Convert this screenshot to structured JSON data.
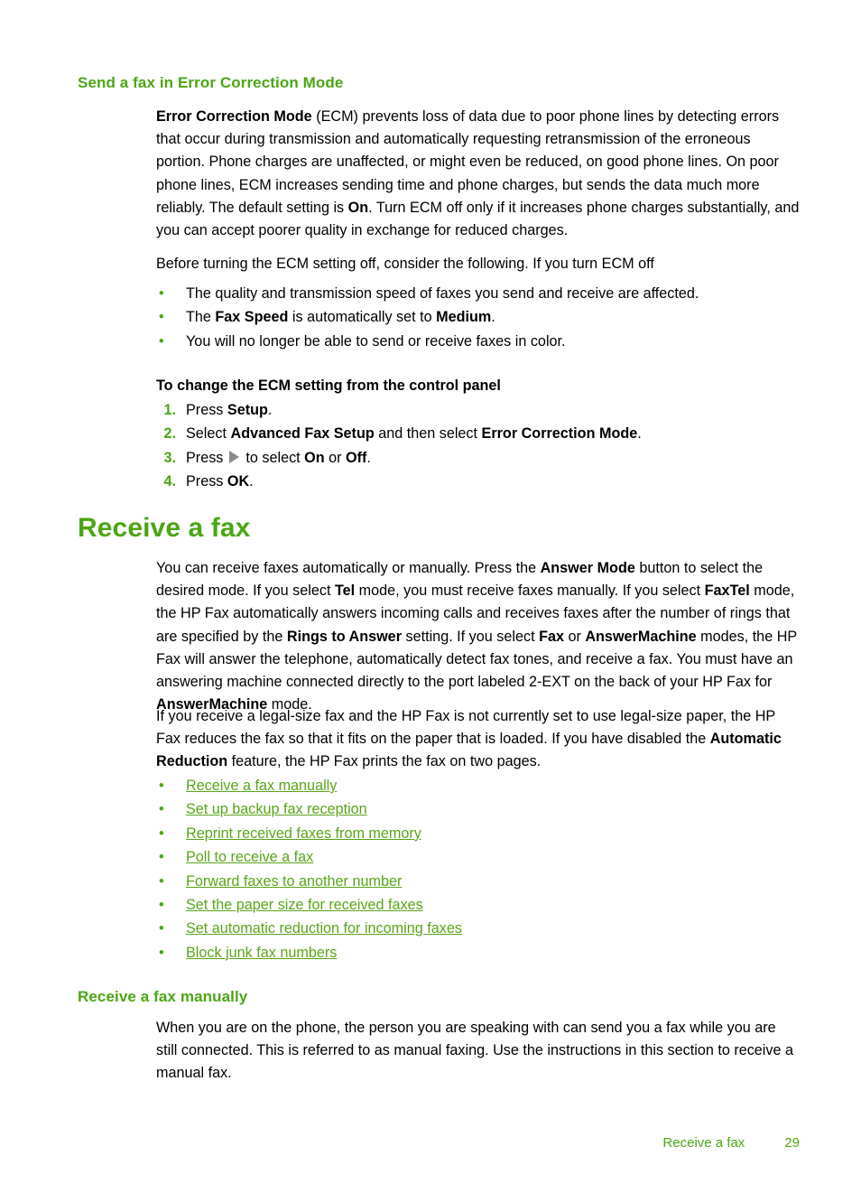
{
  "colors": {
    "heading_green": "#4ba614",
    "link_green": "#58a618",
    "body_black": "#000000",
    "arrow_gray": "#8a8a8a"
  },
  "section_ecm": {
    "heading": "Send a fax in Error Correction Mode",
    "paragraph_lead_bold": "Error Correction Mode",
    "paragraph_rest_1": " (ECM) prevents loss of data due to poor phone lines by detecting errors that occur during transmission and automatically requesting retransmission of the erroneous portion. Phone charges are unaffected, or might even be reduced, on good phone lines. On poor phone lines, ECM increases sending time and phone charges, but sends the data much more reliably. The default setting is ",
    "paragraph_bold_2": "On",
    "paragraph_rest_2": ". Turn ECM off only if it increases phone charges substantially, and you can accept poorer quality in exchange for reduced charges.",
    "intro": "Before turning the ECM setting off, consider the following. If you turn ECM off",
    "bullets": [
      {
        "bullet": "•",
        "pre": "The quality and transmission speed of faxes you send and receive are affected.",
        "bold1": "",
        "mid": "",
        "bold2": "",
        "post": ""
      },
      {
        "bullet": "•",
        "pre": "The ",
        "bold1": "Fax Speed",
        "mid": " is automatically set to ",
        "bold2": "Medium",
        "post": "."
      },
      {
        "bullet": "•",
        "pre": "You will no longer be able to send or receive faxes in color.",
        "bold1": "",
        "mid": "",
        "bold2": "",
        "post": ""
      }
    ],
    "procedure_title": "To change the ECM setting from the control panel",
    "steps": [
      {
        "num": "1.",
        "pre": "Press ",
        "bold1": "Setup",
        "mid": "",
        "bold2": "",
        "post": ".",
        "has_arrow": false
      },
      {
        "num": "2.",
        "pre": "Select ",
        "bold1": "Advanced Fax Setup",
        "mid": " and then select ",
        "bold2": "Error Correction Mode",
        "post": ".",
        "has_arrow": false
      },
      {
        "num": "3.",
        "pre": "Press ",
        "bold1": "",
        "mid": " to select ",
        "bold2": "On",
        "post": " or ",
        "has_arrow": true,
        "tail_bold": "Off",
        "tail_post": "."
      },
      {
        "num": "4.",
        "pre": "Press ",
        "bold1": "OK",
        "mid": "",
        "bold2": "",
        "post": ".",
        "has_arrow": false
      }
    ],
    "arrow_icon": "right-arrow-glyph"
  },
  "section_receive": {
    "heading": "Receive a fax",
    "para1": {
      "t1": "You can receive faxes automatically or manually. Press the ",
      "b1": "Answer Mode",
      "t2": " button to select the desired mode. If you select ",
      "b2": "Tel",
      "t3": " mode, you must receive faxes manually. If you select ",
      "b3": "FaxTel",
      "t4": " mode, the HP Fax automatically answers incoming calls and receives faxes after the number of rings that are specified by the ",
      "b4": "Rings to Answer",
      "t5": " setting. If you select ",
      "b5": "Fax",
      "t6": " or ",
      "b6": "AnswerMachine",
      "t7": " modes, the HP Fax will answer the telephone, automatically detect fax tones, and receive a fax. You must have an answering machine connected directly to the port labeled 2-EXT on the back of your HP Fax for ",
      "b7": "AnswerMachine",
      "t8": " mode."
    },
    "para2": {
      "t1": "If you receive a legal-size fax and the HP Fax is not currently set to use legal-size paper, the HP Fax reduces the fax so that it fits on the paper that is loaded. If you have disabled the ",
      "b1": "Automatic Reduction",
      "t2": " feature, the HP Fax prints the fax on two pages."
    },
    "links": [
      {
        "bullet": "•",
        "label": "Receive a fax manually"
      },
      {
        "bullet": "•",
        "label": "Set up backup fax reception"
      },
      {
        "bullet": "•",
        "label": "Reprint received faxes from memory"
      },
      {
        "bullet": "•",
        "label": "Poll to receive a fax"
      },
      {
        "bullet": "•",
        "label": "Forward faxes to another number"
      },
      {
        "bullet": "•",
        "label": "Set the paper size for received faxes"
      },
      {
        "bullet": "•",
        "label": "Set automatic reduction for incoming faxes"
      },
      {
        "bullet": "•",
        "label": "Block junk fax numbers"
      }
    ]
  },
  "section_manual": {
    "heading": "Receive a fax manually",
    "paragraph": "When you are on the phone, the person you are speaking with can send you a fax while you are still connected. This is referred to as manual faxing. Use the instructions in this section to receive a manual fax."
  },
  "footer": {
    "title": "Receive a fax",
    "page_number": "29"
  }
}
